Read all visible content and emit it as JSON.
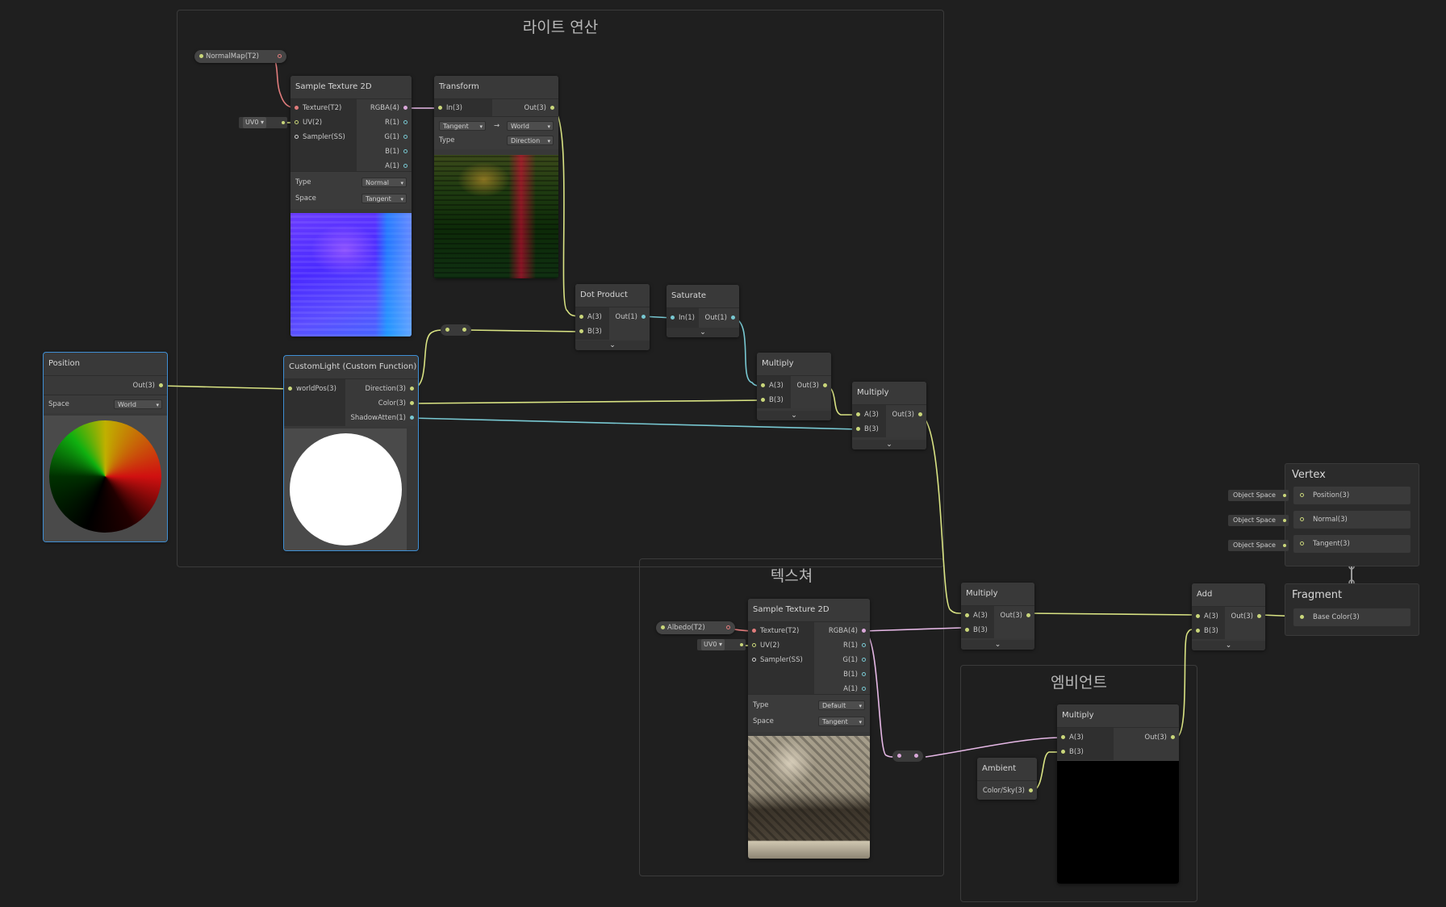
{
  "groups": {
    "light": "라이트 연산",
    "texture": "텍스쳐",
    "ambient": "엠비언트"
  },
  "properties": {
    "normal_map": "NormalMap(T2)",
    "albedo": "Albedo(T2)"
  },
  "inline_values": {
    "uv_channel": "UV0"
  },
  "sample_tex_normal": {
    "title": "Sample Texture 2D",
    "inputs": [
      "Texture(T2)",
      "UV(2)",
      "Sampler(SS)"
    ],
    "outputs": [
      "RGBA(4)",
      "R(1)",
      "G(1)",
      "B(1)",
      "A(1)"
    ],
    "type_label": "Type",
    "type_value": "Normal",
    "space_label": "Space",
    "space_value": "Tangent"
  },
  "transform": {
    "title": "Transform",
    "input": "In(3)",
    "output": "Out(3)",
    "from": "Tangent",
    "arrow": "→",
    "to": "World",
    "type_label": "Type",
    "type_value": "Direction"
  },
  "dot_product": {
    "title": "Dot Product",
    "inputs": [
      "A(3)",
      "B(3)"
    ],
    "output": "Out(1)"
  },
  "saturate": {
    "title": "Saturate",
    "input": "In(1)",
    "output": "Out(1)"
  },
  "position": {
    "title": "Position",
    "output": "Out(3)",
    "space_label": "Space",
    "space_value": "World"
  },
  "custom_light": {
    "title": "CustomLight (Custom Function)",
    "input": "worldPos(3)",
    "outputs": [
      "Direction(3)",
      "Color(3)",
      "ShadowAtten(1)"
    ]
  },
  "multiply1": {
    "title": "Multiply",
    "inputs": [
      "A(3)",
      "B(3)"
    ],
    "output": "Out(3)"
  },
  "multiply2": {
    "title": "Multiply",
    "inputs": [
      "A(3)",
      "B(3)"
    ],
    "output": "Out(3)"
  },
  "multiply3": {
    "title": "Multiply",
    "inputs": [
      "A(3)",
      "B(3)"
    ],
    "output": "Out(3)"
  },
  "multiply_ambient": {
    "title": "Multiply",
    "inputs": [
      "A(3)",
      "B(3)"
    ],
    "output": "Out(3)"
  },
  "add": {
    "title": "Add",
    "inputs": [
      "A(3)",
      "B(3)"
    ],
    "output": "Out(3)"
  },
  "sample_tex_albedo": {
    "title": "Sample Texture 2D",
    "inputs": [
      "Texture(T2)",
      "UV(2)",
      "Sampler(SS)"
    ],
    "outputs": [
      "RGBA(4)",
      "R(1)",
      "G(1)",
      "B(1)",
      "A(1)"
    ],
    "type_label": "Type",
    "type_value": "Default",
    "space_label": "Space",
    "space_value": "Tangent"
  },
  "ambient": {
    "title": "Ambient",
    "output": "Color/Sky(3)"
  },
  "vertex": {
    "title": "Vertex",
    "blocks": [
      "Position(3)",
      "Normal(3)",
      "Tangent(3)"
    ],
    "bound_value": "Object Space"
  },
  "fragment": {
    "title": "Fragment",
    "blocks": [
      "Base Color(3)"
    ]
  },
  "colors": {
    "background": "#1f1f1f",
    "node": "#383838",
    "float_wire": "#d9e383",
    "vector1_wire": "#78c8d2",
    "texture_wire": "#e07c7c",
    "vector4_wire": "#e6b8e6",
    "selection": "#3f8fd4"
  }
}
